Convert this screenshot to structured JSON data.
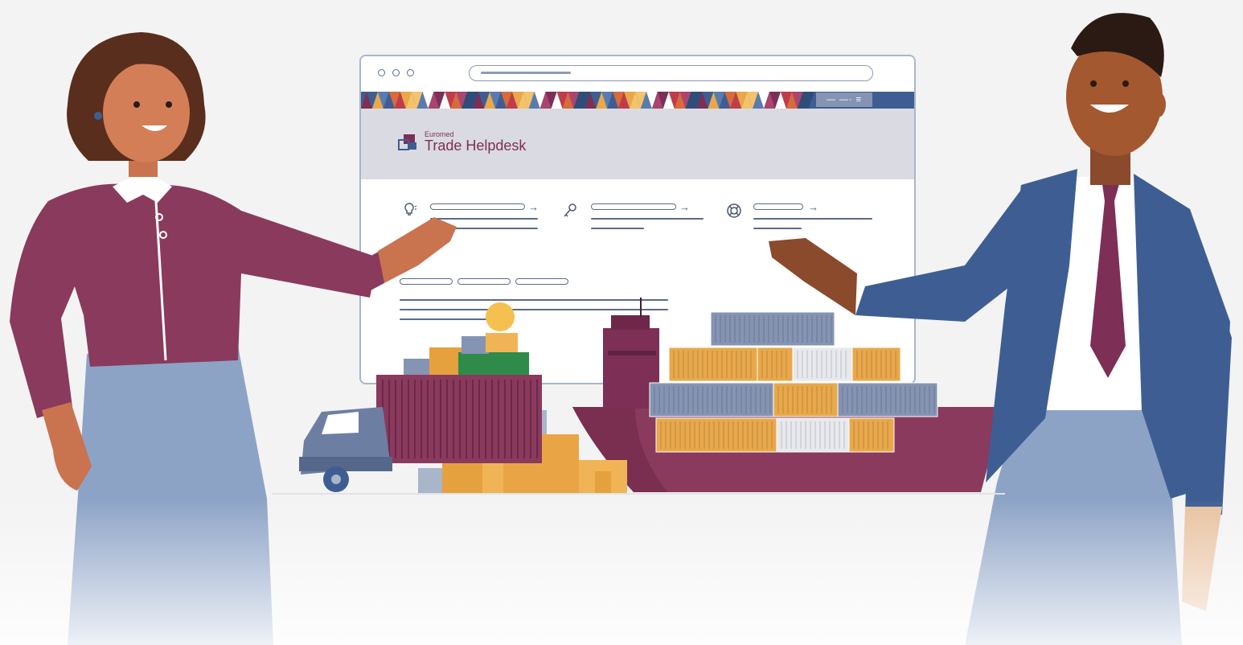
{
  "brand": {
    "name_small": "Euromed",
    "name_large": "Trade Helpdesk"
  },
  "browser": {
    "window_controls": [
      "circle-icon",
      "circle-icon",
      "circle-icon"
    ],
    "menu_chip_glyphs": "— —· ≡"
  },
  "icons": [
    "lightbulb-icon",
    "key-icon",
    "lifebuoy-icon"
  ],
  "colors": {
    "brand_maroon": "#7d2f56",
    "jacket_blue": "#3e5e93",
    "trousers_blue": "#8da3c6",
    "container_orange": "#e8a84b",
    "background": "#f3f3f4"
  }
}
